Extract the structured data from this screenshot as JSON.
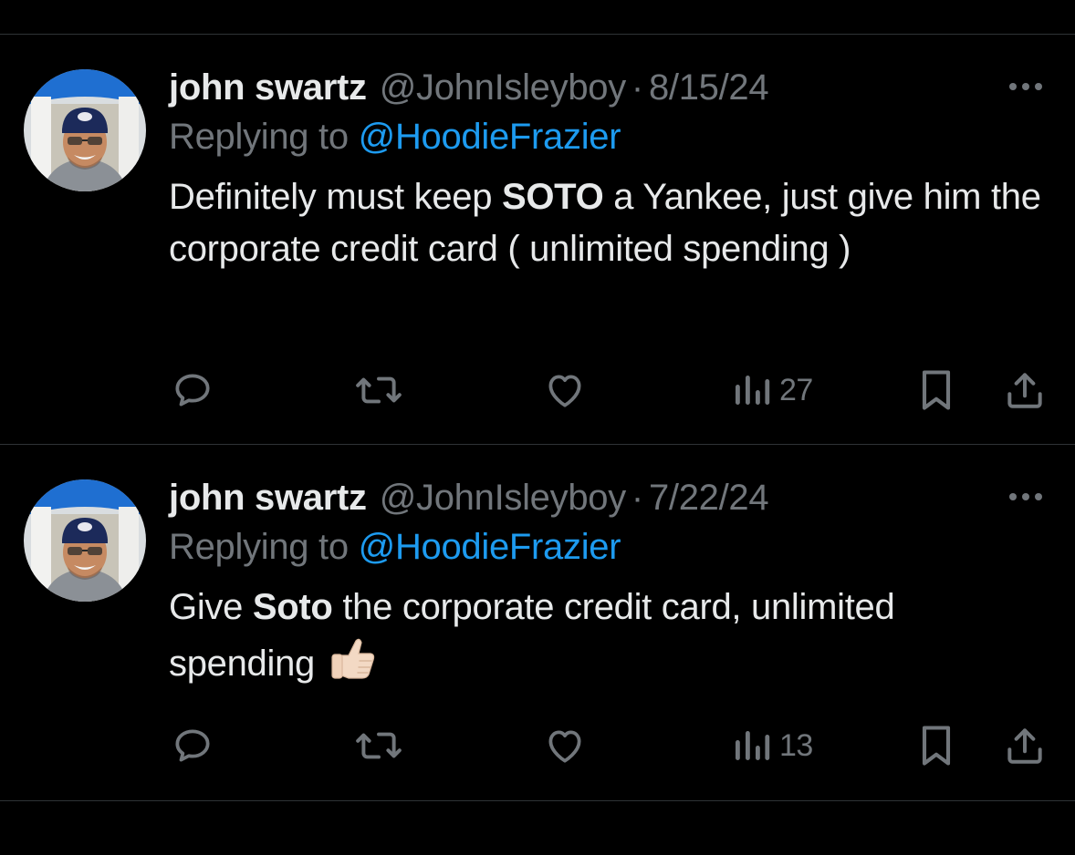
{
  "tweets": [
    {
      "display_name": "john swartz",
      "handle": "@JohnIsleyboy",
      "separator": "·",
      "date": "8/15/24",
      "reply_prefix": "Replying to ",
      "reply_to": "@HoodieFrazier",
      "text_before": "Definitely must keep ",
      "text_bold": "SOTO",
      "text_after": " a Yankee, just give him the corporate credit card ( unlimited spending )",
      "views": "27",
      "icons": [
        "reply-icon",
        "retweet-icon",
        "like-icon",
        "views-icon",
        "bookmark-icon",
        "share-icon",
        "more-icon"
      ]
    },
    {
      "display_name": "john swartz",
      "handle": "@JohnIsleyboy",
      "separator": "·",
      "date": "7/22/24",
      "reply_prefix": "Replying to ",
      "reply_to": "@HoodieFrazier",
      "text_before": "Give ",
      "text_bold": "Soto",
      "text_after": " the corporate credit card, unlimited spending ",
      "emoji": "thumbs-up-emoji",
      "views": "13",
      "icons": [
        "reply-icon",
        "retweet-icon",
        "like-icon",
        "views-icon",
        "bookmark-icon",
        "share-icon",
        "more-icon"
      ]
    }
  ],
  "colors": {
    "background": "#000000",
    "text_primary": "#e7e9ea",
    "text_secondary": "#71767b",
    "link": "#1d9bf0",
    "divider": "#2f3336"
  }
}
